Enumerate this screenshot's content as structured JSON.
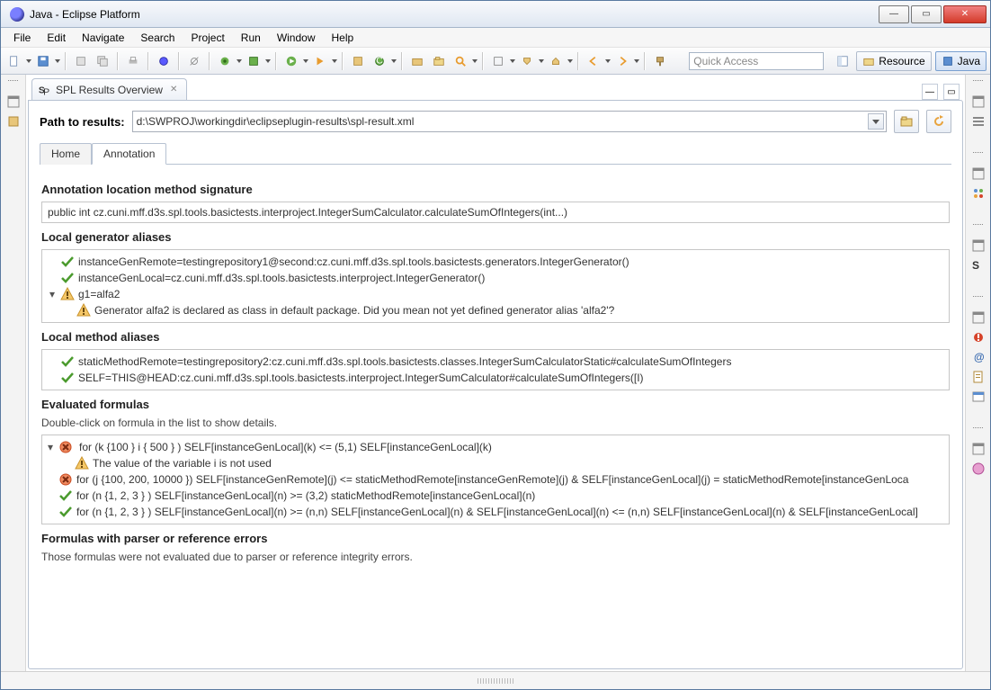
{
  "window": {
    "title": "Java - Eclipse Platform"
  },
  "menu": [
    "File",
    "Edit",
    "Navigate",
    "Search",
    "Project",
    "Run",
    "Window",
    "Help"
  ],
  "quick_access_placeholder": "Quick Access",
  "persp": {
    "resource": "Resource",
    "java": "Java"
  },
  "view": {
    "tab_title": "SPL Results Overview"
  },
  "path": {
    "label": "Path to results:",
    "value": "d:\\SWPROJ\\workingdir\\eclipseplugin-results\\spl-result.xml"
  },
  "tabs": {
    "home": "Home",
    "annotation": "Annotation"
  },
  "sections": {
    "anno_loc": "Annotation location method signature",
    "signature": "public int cz.cuni.mff.d3s.spl.tools.basictests.interproject.IntegerSumCalculator.calculateSumOfIntegers(int...)",
    "gen_aliases": "Local generator aliases",
    "gen_items": [
      {
        "status": "ok",
        "text": "instanceGenRemote=testingrepository1@second:cz.cuni.mff.d3s.spl.tools.basictests.generators.IntegerGenerator()"
      },
      {
        "status": "ok",
        "text": "instanceGenLocal=cz.cuni.mff.d3s.spl.tools.basictests.interproject.IntegerGenerator()"
      },
      {
        "status": "warn",
        "text": "g1=alfa2",
        "expanded": true,
        "children": [
          {
            "status": "warn",
            "text": "Generator alfa2 is declared as class in default package. Did you mean not yet defined generator alias 'alfa2'?"
          }
        ]
      }
    ],
    "method_aliases": "Local method aliases",
    "method_items": [
      {
        "status": "ok",
        "text": "staticMethodRemote=testingrepository2:cz.cuni.mff.d3s.spl.tools.basictests.classes.IntegerSumCalculatorStatic#calculateSumOfIntegers"
      },
      {
        "status": "ok",
        "text": "SELF=THIS@HEAD:cz.cuni.mff.d3s.spl.tools.basictests.interproject.IntegerSumCalculator#calculateSumOfIntegers([I)"
      }
    ],
    "eval_formulas": "Evaluated formulas",
    "eval_hint": "Double-click on formula in the list to show details.",
    "formulas": [
      {
        "status": "err",
        "expanded": true,
        "selected": true,
        "text": "for (k {100 } i { 500 } ) SELF[instanceGenLocal](k) <= (5,1) SELF[instanceGenLocal](k)",
        "children": [
          {
            "status": "warn",
            "text": "The value of the variable i is not used"
          }
        ]
      },
      {
        "status": "err",
        "text": "for (j {100, 200, 10000 }) SELF[instanceGenRemote](j) <= staticMethodRemote[instanceGenRemote](j) & SELF[instanceGenLocal](j) = staticMethodRemote[instanceGenLoca"
      },
      {
        "status": "ok",
        "text": "for (n {1, 2, 3 } ) SELF[instanceGenLocal](n) >= (3,2) staticMethodRemote[instanceGenLocal](n)"
      },
      {
        "status": "ok",
        "text": "for (n {1, 2, 3 } ) SELF[instanceGenLocal](n) >= (n,n) SELF[instanceGenLocal](n) & SELF[instanceGenLocal](n) <= (n,n) SELF[instanceGenLocal](n) & SELF[instanceGenLocal]"
      }
    ],
    "parser_errors": "Formulas with parser or reference errors",
    "parser_hint": "Those formulas were not evaluated due to parser or reference integrity errors."
  }
}
